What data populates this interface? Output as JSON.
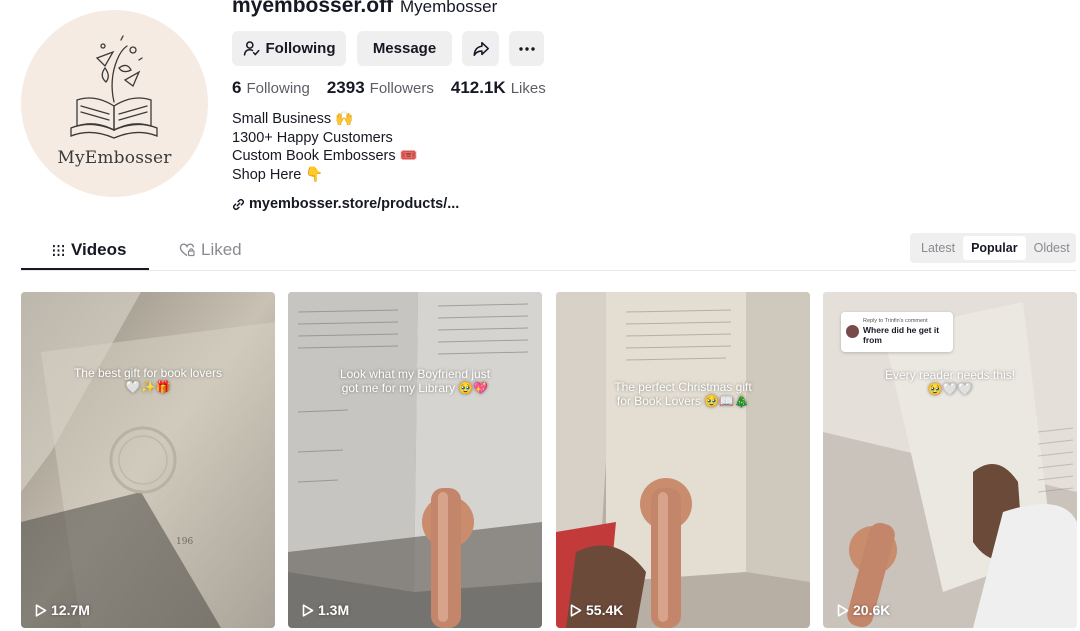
{
  "profile": {
    "username": "myembosser.off",
    "nickname": "Myembosser",
    "avatar_text": "MyEmbosser",
    "buttons": {
      "following": "Following",
      "message": "Message"
    },
    "stats": {
      "following_count": "6",
      "following_label": "Following",
      "followers_count": "2393",
      "followers_label": "Followers",
      "likes_count": "412.1K",
      "likes_label": "Likes"
    },
    "bio": [
      "Small Business 🙌",
      "1300+ Happy Customers",
      "Custom Book Embossers 🎟️",
      "Shop Here 👇"
    ],
    "link": "myembosser.store/products/..."
  },
  "tabs": {
    "videos": "Videos",
    "liked": "Liked"
  },
  "sort": {
    "options": [
      "Latest",
      "Popular",
      "Oldest"
    ],
    "active": "Popular"
  },
  "videos": [
    {
      "caption_1": "The best gift for book lovers",
      "caption_2": "🤍✨🎁",
      "views": "12.7M"
    },
    {
      "caption_1": "Look what my Boyfriend just",
      "caption_2": "got me for my Library 🥹💖",
      "views": "1.3M"
    },
    {
      "caption_1": "The perfect Christmas gift",
      "caption_2": "for Book Lovers 🥹📖🎄",
      "views": "55.4K"
    },
    {
      "caption_1": "Every reader needs this!",
      "caption_2": "🥹🤍🤍",
      "views": "20.6K",
      "reply_small": "Reply to Trinfin's comment",
      "reply_main": "Where did he get it from"
    }
  ],
  "colors": {
    "text_primary": "#161823",
    "text_secondary": "#5c5d66",
    "button_bg": "#efeff0",
    "avatar_bg": "#f6ebe3"
  }
}
